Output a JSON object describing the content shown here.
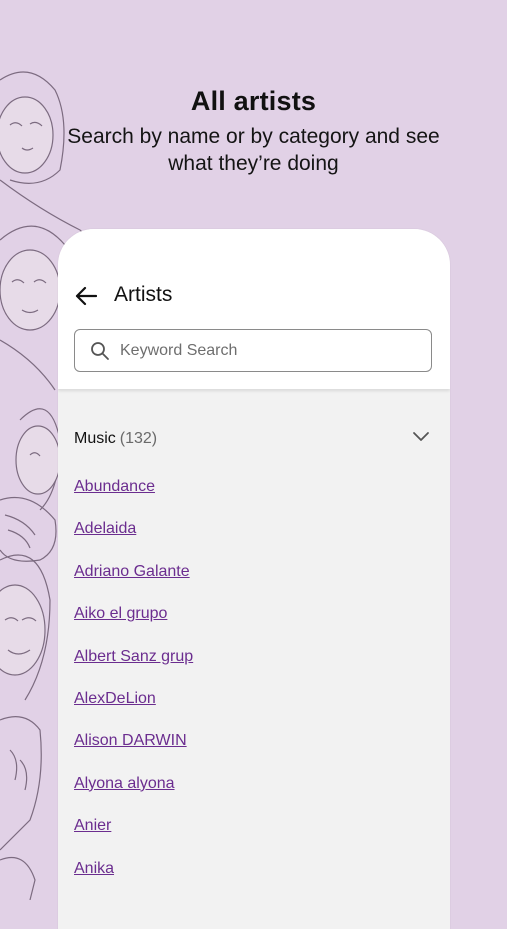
{
  "promo": {
    "title": "All artists",
    "subtitle": "Search by name or by category and see what they’re doing"
  },
  "colors": {
    "background": "#e1d1e6",
    "link": "#6b2d8f",
    "card": "#f2f2f2"
  },
  "screen": {
    "header": {
      "back_icon": "arrow-left-icon",
      "title": "Artists"
    },
    "search": {
      "icon": "search-icon",
      "placeholder": "Keyword Search",
      "value": ""
    },
    "category": {
      "name": "Music",
      "count": "(132)",
      "icon": "chevron-down-icon"
    },
    "artists": [
      "Abundance",
      "Adelaida",
      "Adriano Galante",
      "Aiko el grupo",
      "Albert Sanz grup",
      "AlexDeLion",
      "Alison DARWIN",
      "Alyona alyona",
      "Anier",
      "Anika"
    ]
  }
}
